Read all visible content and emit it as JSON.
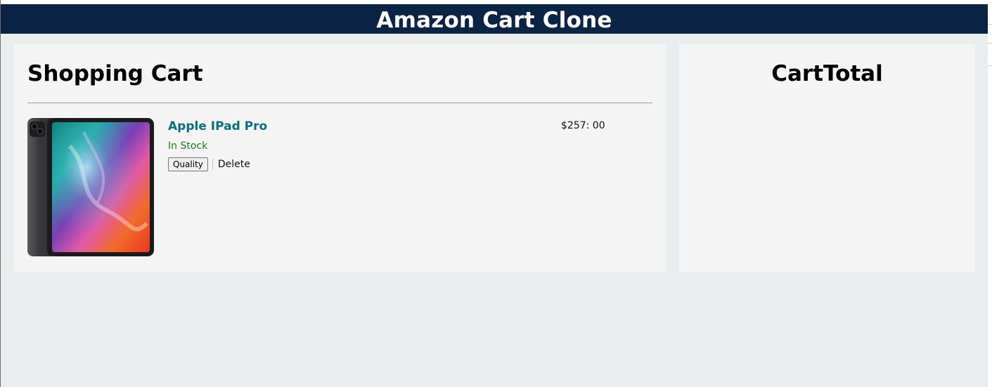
{
  "header": {
    "title": "Amazon Cart Clone"
  },
  "cart": {
    "title": "Shopping Cart",
    "items": [
      {
        "name": "Apple IPad Pro",
        "stock": "In Stock",
        "quantity_label": "Quality",
        "delete_label": "Delete",
        "price": "$257: 00",
        "image_icon": "ipad-product-image"
      }
    ]
  },
  "total": {
    "title": "CartTotal"
  },
  "colors": {
    "header_bg": "#0b2444",
    "page_bg": "#eaeded",
    "panel_bg": "#f4f4f4",
    "product_link": "#0d6e7c",
    "in_stock": "#1f7a1f"
  }
}
